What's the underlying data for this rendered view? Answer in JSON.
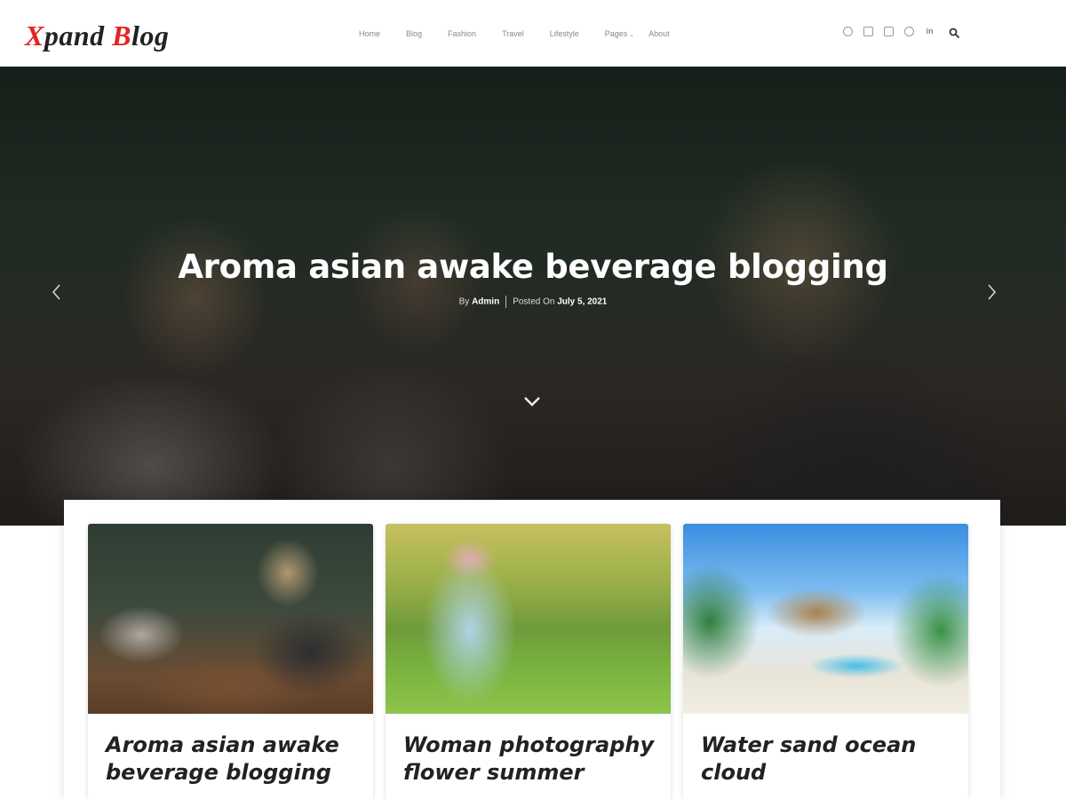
{
  "header": {
    "logo": {
      "part1": "X",
      "part2": "pand ",
      "part3": "B",
      "part4": "log"
    },
    "nav": [
      {
        "label": "Home"
      },
      {
        "label": "Blog"
      },
      {
        "label": "Fashion"
      },
      {
        "label": "Travel"
      },
      {
        "label": "Lifestyle"
      },
      {
        "label": "Pages",
        "has_dropdown": true
      },
      {
        "label": "About"
      }
    ],
    "social_icons": [
      "facebook-icon",
      "twitter-icon",
      "instagram-icon",
      "pinterest-icon",
      "linkedin-icon"
    ],
    "search_icon": "search-icon"
  },
  "hero": {
    "title": "Aroma asian awake beverage blogging",
    "by_label": "By ",
    "author": "Admin",
    "posted_label": "Posted On ",
    "date": "July 5, 2021"
  },
  "posts": [
    {
      "title": "Aroma asian awake beverage blogging"
    },
    {
      "title": "Woman photography flower summer"
    },
    {
      "title": "Water sand ocean cloud"
    }
  ],
  "colors": {
    "brand_red": "#e32323",
    "text_dark": "#222222",
    "nav_gray": "#888888"
  }
}
